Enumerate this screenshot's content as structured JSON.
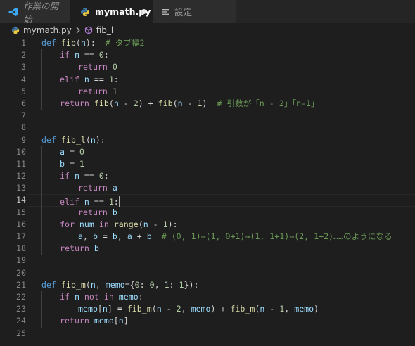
{
  "tabs": {
    "welcome": "作業の開始",
    "file": "mymath.py",
    "settings": "設定"
  },
  "breadcrumb": {
    "file": "mymath.py",
    "symbol": "fib_l"
  },
  "cursor_line": 14,
  "lines": [
    {
      "n": "1",
      "indent": 0,
      "tokens": [
        [
          "kb",
          "def "
        ],
        [
          "fn",
          "fib"
        ],
        [
          "op",
          "("
        ],
        [
          "vr",
          "n"
        ],
        [
          "op",
          "):  "
        ],
        [
          "cm",
          "# タブ幅2"
        ]
      ]
    },
    {
      "n": "2",
      "indent": 1,
      "tokens": [
        [
          "kw",
          "if "
        ],
        [
          "vr",
          "n"
        ],
        [
          "op",
          " == "
        ],
        [
          "nm",
          "0"
        ],
        [
          "op",
          ":"
        ]
      ]
    },
    {
      "n": "3",
      "indent": 2,
      "tokens": [
        [
          "kw",
          "return "
        ],
        [
          "nm",
          "0"
        ]
      ]
    },
    {
      "n": "4",
      "indent": 1,
      "tokens": [
        [
          "kw",
          "elif "
        ],
        [
          "vr",
          "n"
        ],
        [
          "op",
          " == "
        ],
        [
          "nm",
          "1"
        ],
        [
          "op",
          ":"
        ]
      ]
    },
    {
      "n": "5",
      "indent": 2,
      "tokens": [
        [
          "kw",
          "return "
        ],
        [
          "nm",
          "1"
        ]
      ]
    },
    {
      "n": "6",
      "indent": 1,
      "tokens": [
        [
          "kw",
          "return "
        ],
        [
          "fn",
          "fib"
        ],
        [
          "op",
          "("
        ],
        [
          "vr",
          "n"
        ],
        [
          "op",
          " - "
        ],
        [
          "nm",
          "2"
        ],
        [
          "op",
          ") + "
        ],
        [
          "fn",
          "fib"
        ],
        [
          "op",
          "("
        ],
        [
          "vr",
          "n"
        ],
        [
          "op",
          " - "
        ],
        [
          "nm",
          "1"
        ],
        [
          "op",
          ")  "
        ],
        [
          "cm",
          "# 引数が「n - 2」「n-1」"
        ]
      ]
    },
    {
      "n": "7",
      "indent": 0,
      "tokens": []
    },
    {
      "n": "8",
      "indent": 0,
      "tokens": []
    },
    {
      "n": "9",
      "indent": 0,
      "tokens": [
        [
          "kb",
          "def "
        ],
        [
          "fn",
          "fib_l"
        ],
        [
          "op",
          "("
        ],
        [
          "vr",
          "n"
        ],
        [
          "op",
          "):"
        ]
      ]
    },
    {
      "n": "10",
      "indent": 1,
      "tokens": [
        [
          "vr",
          "a"
        ],
        [
          "op",
          " = "
        ],
        [
          "nm",
          "0"
        ]
      ]
    },
    {
      "n": "11",
      "indent": 1,
      "tokens": [
        [
          "vr",
          "b"
        ],
        [
          "op",
          " = "
        ],
        [
          "nm",
          "1"
        ]
      ]
    },
    {
      "n": "12",
      "indent": 1,
      "tokens": [
        [
          "kw",
          "if "
        ],
        [
          "vr",
          "n"
        ],
        [
          "op",
          " == "
        ],
        [
          "nm",
          "0"
        ],
        [
          "op",
          ":"
        ]
      ]
    },
    {
      "n": "13",
      "indent": 2,
      "tokens": [
        [
          "kw",
          "return "
        ],
        [
          "vr",
          "a"
        ]
      ]
    },
    {
      "n": "14",
      "indent": 1,
      "tokens": [
        [
          "kw",
          "elif "
        ],
        [
          "vr",
          "n"
        ],
        [
          "op",
          " == "
        ],
        [
          "nm",
          "1"
        ],
        [
          "op",
          ":"
        ]
      ]
    },
    {
      "n": "15",
      "indent": 2,
      "tokens": [
        [
          "kw",
          "return "
        ],
        [
          "vr",
          "b"
        ]
      ]
    },
    {
      "n": "16",
      "indent": 1,
      "tokens": [
        [
          "kw",
          "for "
        ],
        [
          "vr",
          "num"
        ],
        [
          "kw",
          " in "
        ],
        [
          "fn",
          "range"
        ],
        [
          "op",
          "("
        ],
        [
          "vr",
          "n"
        ],
        [
          "op",
          " - "
        ],
        [
          "nm",
          "1"
        ],
        [
          "op",
          "):"
        ]
      ]
    },
    {
      "n": "17",
      "indent": 2,
      "tokens": [
        [
          "vr",
          "a"
        ],
        [
          "op",
          ", "
        ],
        [
          "vr",
          "b"
        ],
        [
          "op",
          " = "
        ],
        [
          "vr",
          "b"
        ],
        [
          "op",
          ", "
        ],
        [
          "vr",
          "a"
        ],
        [
          "op",
          " + "
        ],
        [
          "vr",
          "b"
        ],
        [
          "op",
          "  "
        ],
        [
          "cm",
          "# (0, 1)→(1, 0+1)→(1, 1+1)→(2, 1+2)……のようになる"
        ]
      ]
    },
    {
      "n": "18",
      "indent": 1,
      "tokens": [
        [
          "kw",
          "return "
        ],
        [
          "vr",
          "b"
        ]
      ]
    },
    {
      "n": "19",
      "indent": 0,
      "tokens": []
    },
    {
      "n": "20",
      "indent": 0,
      "tokens": []
    },
    {
      "n": "21",
      "indent": 0,
      "tokens": [
        [
          "kb",
          "def "
        ],
        [
          "fn",
          "fib_m"
        ],
        [
          "op",
          "("
        ],
        [
          "vr",
          "n"
        ],
        [
          "op",
          ", "
        ],
        [
          "vr",
          "memo"
        ],
        [
          "op",
          "={"
        ],
        [
          "nm",
          "0"
        ],
        [
          "op",
          ": "
        ],
        [
          "nm",
          "0"
        ],
        [
          "op",
          ", "
        ],
        [
          "nm",
          "1"
        ],
        [
          "op",
          ": "
        ],
        [
          "nm",
          "1"
        ],
        [
          "op",
          "}):"
        ]
      ]
    },
    {
      "n": "22",
      "indent": 1,
      "tokens": [
        [
          "kw",
          "if "
        ],
        [
          "vr",
          "n"
        ],
        [
          "kw",
          " not in "
        ],
        [
          "vr",
          "memo"
        ],
        [
          "op",
          ":"
        ]
      ]
    },
    {
      "n": "23",
      "indent": 2,
      "tokens": [
        [
          "vr",
          "memo"
        ],
        [
          "op",
          "["
        ],
        [
          "vr",
          "n"
        ],
        [
          "op",
          "] = "
        ],
        [
          "fn",
          "fib_m"
        ],
        [
          "op",
          "("
        ],
        [
          "vr",
          "n"
        ],
        [
          "op",
          " - "
        ],
        [
          "nm",
          "2"
        ],
        [
          "op",
          ", "
        ],
        [
          "vr",
          "memo"
        ],
        [
          "op",
          ") + "
        ],
        [
          "fn",
          "fib_m"
        ],
        [
          "op",
          "("
        ],
        [
          "vr",
          "n"
        ],
        [
          "op",
          " - "
        ],
        [
          "nm",
          "1"
        ],
        [
          "op",
          ", "
        ],
        [
          "vr",
          "memo"
        ],
        [
          "op",
          ")"
        ]
      ]
    },
    {
      "n": "24",
      "indent": 1,
      "tokens": [
        [
          "kw",
          "return "
        ],
        [
          "vr",
          "memo"
        ],
        [
          "op",
          "["
        ],
        [
          "vr",
          "n"
        ],
        [
          "op",
          "]"
        ]
      ]
    },
    {
      "n": "25",
      "indent": 0,
      "tokens": []
    }
  ]
}
